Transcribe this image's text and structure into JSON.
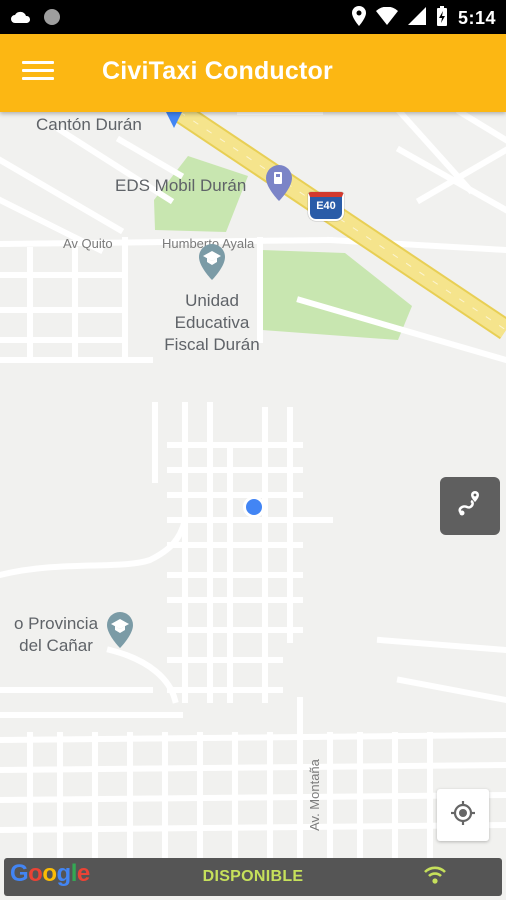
{
  "status_bar": {
    "time": "5:14",
    "icons": [
      "cloud-icon",
      "circle-icon",
      "location-icon",
      "wifi-icon",
      "signal-icon",
      "battery-charging-icon"
    ]
  },
  "app_bar": {
    "title": "CiviTaxi Conductor",
    "menu_icon": "hamburger-menu-icon"
  },
  "map": {
    "labels": {
      "canton": "Cantón Durán",
      "eds": "EDS Mobil Durán",
      "highway_badge": "E40",
      "av_quito": "Av Quito",
      "humberto": "Humberto Ayala",
      "school_line1": "Unidad",
      "school_line2": "Educativa",
      "school_line3": "Fiscal Durán",
      "provincia_line1": "o Provincia",
      "provincia_line2": "del Cañar",
      "av_montana": "Av. Montaña"
    },
    "colors": {
      "highway": "#f5e48c",
      "park": "#c8e6b0",
      "street": "#ffffff",
      "background": "#f1f1ef",
      "current_location": "#4285f4"
    }
  },
  "buttons": {
    "route_icon": "route-icon",
    "my_location_icon": "my-location-icon"
  },
  "footer": {
    "google_logo": "Google",
    "status": "DISPONIBLE",
    "connection_icon": "wifi-icon",
    "status_color": "#c6e05b"
  }
}
